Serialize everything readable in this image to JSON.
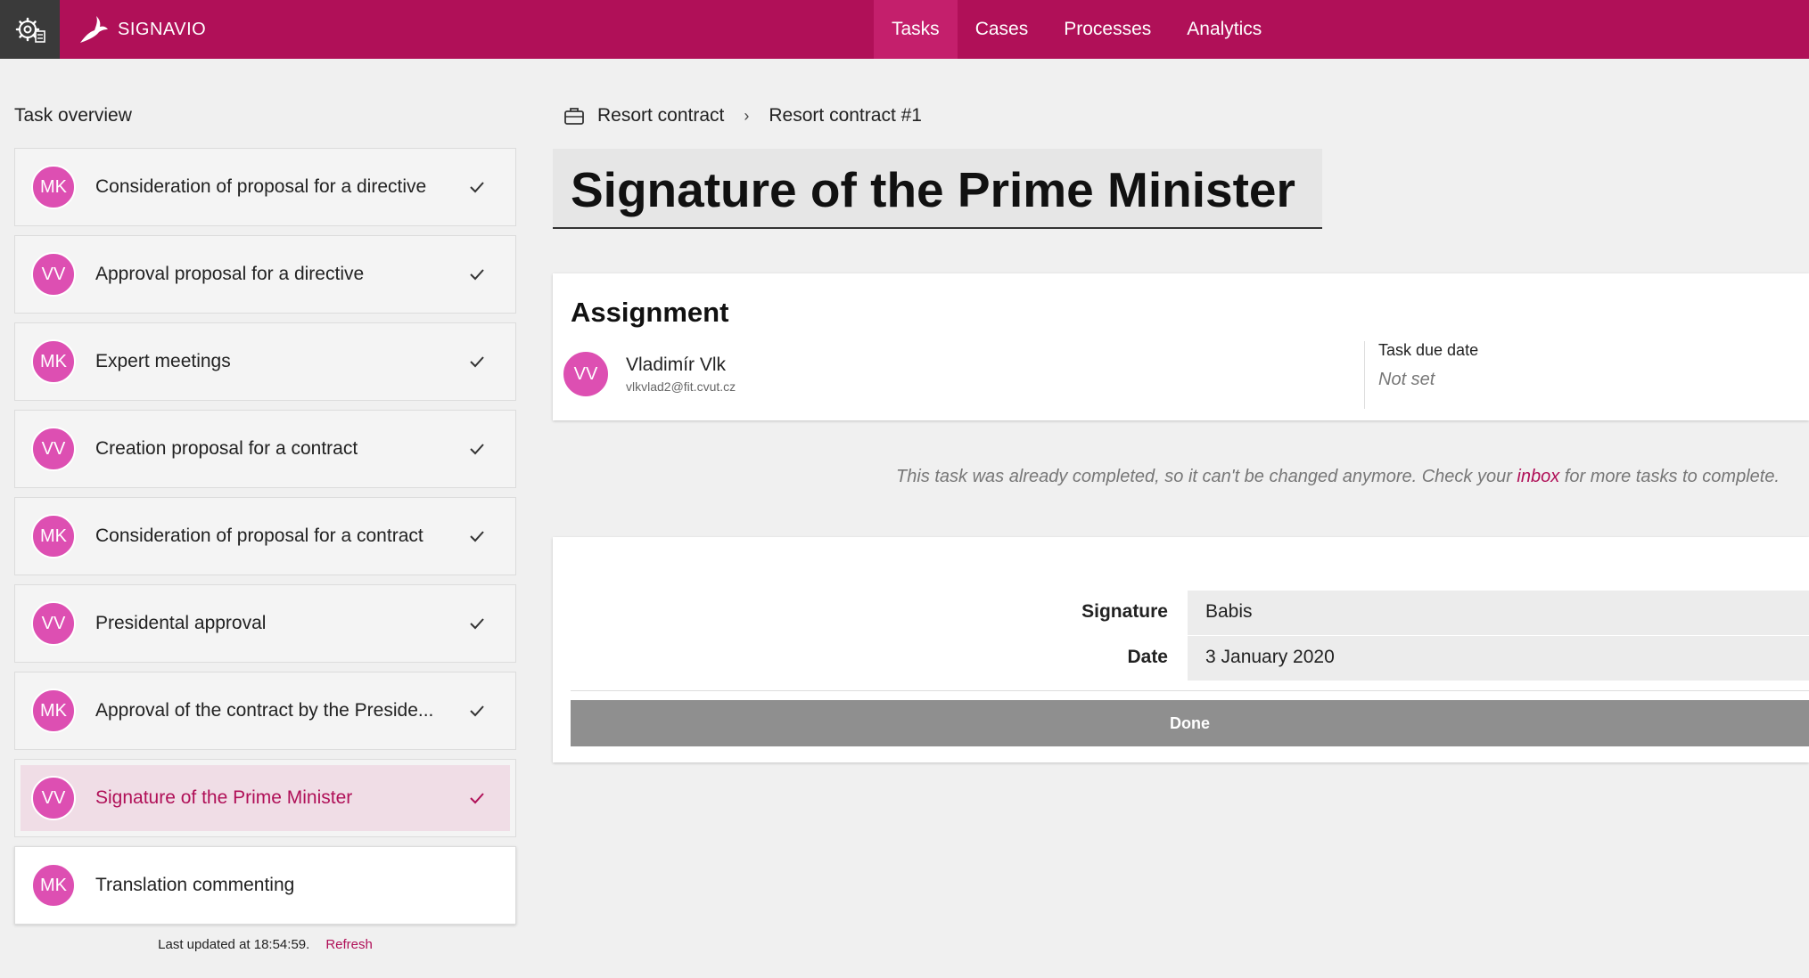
{
  "header": {
    "brand_name": "SIGNAVIO",
    "nav": [
      {
        "label": "Tasks",
        "active": true
      },
      {
        "label": "Cases",
        "active": false
      },
      {
        "label": "Processes",
        "active": false
      },
      {
        "label": "Analytics",
        "active": false
      }
    ],
    "brand_color": "#b01058"
  },
  "sidebar": {
    "title": "Task overview",
    "tasks": [
      {
        "initials": "MK",
        "label": "Consideration of proposal for a directive",
        "completed": true
      },
      {
        "initials": "VV",
        "label": "Approval proposal for a directive",
        "completed": true
      },
      {
        "initials": "MK",
        "label": "Expert meetings",
        "completed": true
      },
      {
        "initials": "VV",
        "label": "Creation proposal for a contract",
        "completed": true
      },
      {
        "initials": "MK",
        "label": "Consideration of proposal for a contract",
        "completed": true
      },
      {
        "initials": "VV",
        "label": "Presidental approval",
        "completed": true
      },
      {
        "initials": "MK",
        "label": "Approval of the contract by the Preside...",
        "completed": true
      },
      {
        "initials": "VV",
        "label": "Signature of the Prime Minister",
        "completed": true,
        "selected": true
      },
      {
        "initials": "MK",
        "label": "Translation commenting",
        "completed": false
      }
    ],
    "last_updated": "Last updated at 18:54:59.",
    "refresh_label": "Refresh"
  },
  "main": {
    "breadcrumb": [
      "Resort contract",
      "Resort contract #1"
    ],
    "breadcrumb_separator": "›",
    "title": "Signature of the Prime Minister",
    "assignment": {
      "heading": "Assignment",
      "assignee_initials": "VV",
      "assignee_name": "Vladimír Vlk",
      "assignee_email": "vlkvlad2@fit.cvut.cz",
      "due_label": "Task due date",
      "due_value": "Not set"
    },
    "completed_note": {
      "before": "This task was already completed, so it can't be changed anymore. Check your ",
      "link": "inbox",
      "after": " for more tasks to complete."
    },
    "form": {
      "fields": [
        {
          "label": "Signature",
          "value": "Babis"
        },
        {
          "label": "Date",
          "value": "3 January 2020"
        }
      ],
      "done_label": "Done"
    }
  },
  "colors": {
    "accent": "#b01058",
    "avatar": "#dd4fb2",
    "selected_bg": "#f0dde6",
    "done_button": "#8f8f8f"
  }
}
